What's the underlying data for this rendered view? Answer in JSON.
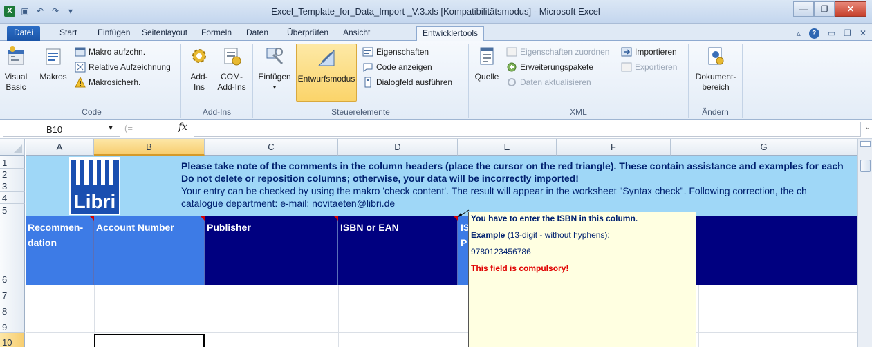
{
  "window": {
    "title": "Excel_Template_for_Data_Import _V.3.xls  [Kompatibilitätsmodus]  -  Microsoft Excel"
  },
  "tabs": [
    {
      "label": "Datei",
      "active": false
    },
    {
      "label": "Start",
      "active": false
    },
    {
      "label": "Einfügen",
      "active": false
    },
    {
      "label": "Seitenlayout",
      "active": false
    },
    {
      "label": "Formeln",
      "active": false
    },
    {
      "label": "Daten",
      "active": false
    },
    {
      "label": "Überprüfen",
      "active": false
    },
    {
      "label": "Ansicht",
      "active": false
    },
    {
      "label": "Entwicklertools",
      "active": true
    }
  ],
  "ribbon": {
    "code": {
      "label": "Code",
      "visual_basic": "Visual Basic",
      "makros": "Makros",
      "makro_aufzeichnen": "Makro aufzchn.",
      "relative_aufzeichnung": "Relative Aufzeichnung",
      "makrosicherheit": "Makrosicherh."
    },
    "addins": {
      "label": "Add-Ins",
      "addins": "Add-Ins",
      "com_addins": "COM-Add-Ins"
    },
    "steuerelemente": {
      "label": "Steuerelemente",
      "einfuegen": "Einfügen",
      "entwurfsmodus": "Entwurfsmodus",
      "eigenschaften": "Eigenschaften",
      "code_anzeigen": "Code anzeigen",
      "dialogfeld": "Dialogfeld ausführen"
    },
    "xml": {
      "label": "XML",
      "quelle": "Quelle",
      "eigenschaften_zuordnen": "Eigenschaften zuordnen",
      "erweiterungspakete": "Erweiterungspakete",
      "daten_aktualisieren": "Daten aktualisieren",
      "importieren": "Importieren",
      "exportieren": "Exportieren"
    },
    "aendern": {
      "label": "Ändern",
      "dokumentbereich": "Dokument-bereich"
    }
  },
  "formula_bar": {
    "name_box": "B10",
    "fx": "fx",
    "value": ""
  },
  "columns": [
    "A",
    "B",
    "C",
    "D",
    "E",
    "F",
    "G"
  ],
  "rows": [
    "1",
    "2",
    "3",
    "4",
    "5",
    "6",
    "7",
    "8",
    "9",
    "10"
  ],
  "notice": {
    "line1": "Please take note of the comments in the column headers (place the cursor on the red triangle). These contain assistance and examples for each",
    "line2": "Do not delete or reposition columns; otherwise, your data will be incorrectly imported!",
    "line3": "Your entry can be checked by using the makro 'check content'. The result will appear in the worksheet \"Syntax check\". Following correction, the ch",
    "line4": "catalogue department: e-mail: novitaeten@libri.de"
  },
  "headers": {
    "a": "Recommen-dation",
    "b": "Account Number",
    "c": "Publisher",
    "d": "ISBN or EAN",
    "e_partial": "IS",
    "e_partial2": "P"
  },
  "comment": {
    "line1": "You have to enter the ISBN in this column.",
    "example_label": "Example",
    "example_rest": " (13-digit - without hyphens):",
    "isbn": "9780123456786",
    "compulsory": "This field is compulsory!"
  },
  "logo_text": "Libri",
  "colors": {
    "band": "#9fd7f7",
    "header_dark": "#000080",
    "header_light": "#3d7be6",
    "comment_bg": "#ffffe1"
  }
}
